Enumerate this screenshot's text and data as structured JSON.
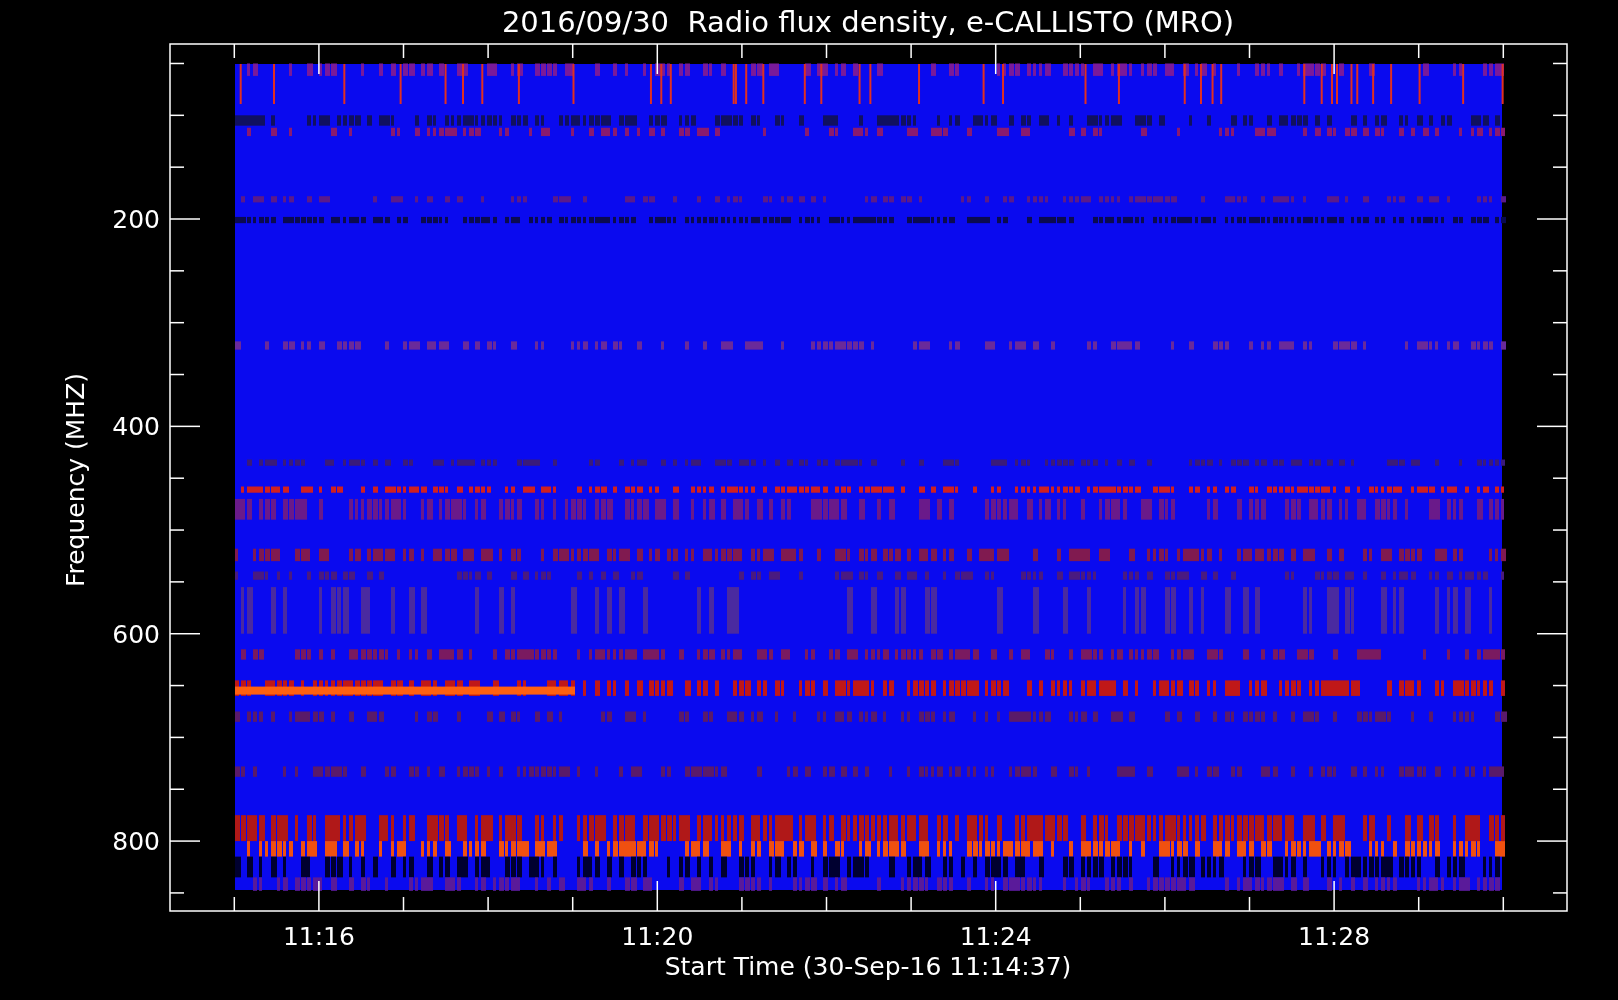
{
  "title": "2016/09/30  Radio flux density, e-CALLISTO (MRO)",
  "plot": {
    "y_axis": {
      "label": "Frequency (MHZ)",
      "ticks": [
        "200",
        "400",
        "600",
        "800"
      ]
    },
    "x_axis": {
      "label": "Start Time (30-Sep-16 11:14:37)",
      "ticks": [
        "11:16",
        "11:20",
        "11:24",
        "11:28"
      ]
    }
  }
}
